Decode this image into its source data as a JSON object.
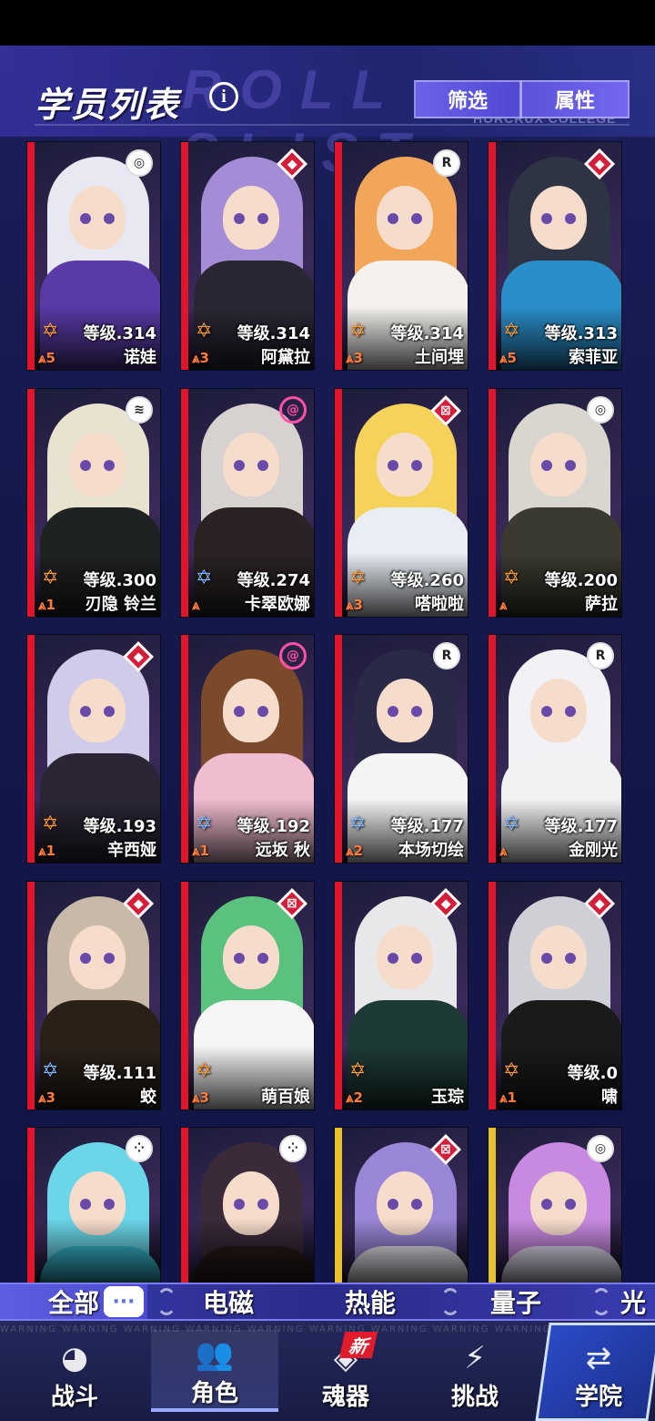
{
  "header": {
    "title": "学员列表",
    "watermark": "ROLL SLIST",
    "sub_watermark": "HORCRUX COLLEGE",
    "filter_label": "筛选",
    "attribute_label": "属性"
  },
  "cards": [
    {
      "name": "诺娃",
      "level": "等级.314",
      "rank": "5",
      "element": "psy"
    },
    {
      "name": "阿黛拉",
      "level": "等级.314",
      "rank": "3",
      "element": "void"
    },
    {
      "name": "土间埋",
      "level": "等级.314",
      "rank": "3",
      "element": "R"
    },
    {
      "name": "索菲亚",
      "level": "等级.313",
      "rank": "5",
      "element": "void"
    },
    {
      "name": "刃隐 铃兰",
      "level": "等级.300",
      "rank": "1",
      "element": "wifi"
    },
    {
      "name": "卡翠欧娜",
      "level": "等级.274",
      "rank": "",
      "element": "swirl"
    },
    {
      "name": "嗒啦啦",
      "level": "等级.260",
      "rank": "3",
      "element": "quantum"
    },
    {
      "name": "萨拉",
      "level": "等级.200",
      "rank": "",
      "element": "psy"
    },
    {
      "name": "辛西娅",
      "level": "等级.193",
      "rank": "1",
      "element": "void"
    },
    {
      "name": "远坂 秋",
      "level": "等级.192",
      "rank": "1",
      "element": "swirl"
    },
    {
      "name": "本场切绘",
      "level": "等级.177",
      "rank": "2",
      "element": "R"
    },
    {
      "name": "金刚光",
      "level": "等级.177",
      "rank": "",
      "element": "R"
    },
    {
      "name": "蛟",
      "level": "等级.111",
      "rank": "3",
      "element": "void"
    },
    {
      "name": "萌百娘",
      "level": "",
      "rank": "3",
      "element": "quantum"
    },
    {
      "name": "玉琮",
      "level": "",
      "rank": "2",
      "element": "void"
    },
    {
      "name": "啸",
      "level": "等级.0",
      "rank": "1",
      "element": "void"
    },
    {
      "name": "",
      "level": "",
      "rank": "",
      "element": "dots"
    },
    {
      "name": "",
      "level": "",
      "rank": "",
      "element": "dots"
    },
    {
      "name": "",
      "level": "",
      "rank": "",
      "element": "quantum"
    },
    {
      "name": "",
      "level": "",
      "rank": "",
      "element": "psy"
    }
  ],
  "tabs": {
    "all": "全部",
    "electromagnetic": "电磁",
    "thermal": "热能",
    "quantum": "量子",
    "light": "光"
  },
  "nav": {
    "warning_strip": "WARNING WARNING WARNING WARNING WARNING WARNING WARNING WARNING WARNING WARNING",
    "battle": "战斗",
    "character": "角色",
    "soul": "魂器",
    "challenge": "挑战",
    "academy": "学院",
    "new_badge": "新",
    "chat_icon": "···"
  },
  "colors": {
    "accent": "#5e5ee0",
    "card_border": "#e0152b",
    "card_border_gold": "#e6c12b"
  }
}
